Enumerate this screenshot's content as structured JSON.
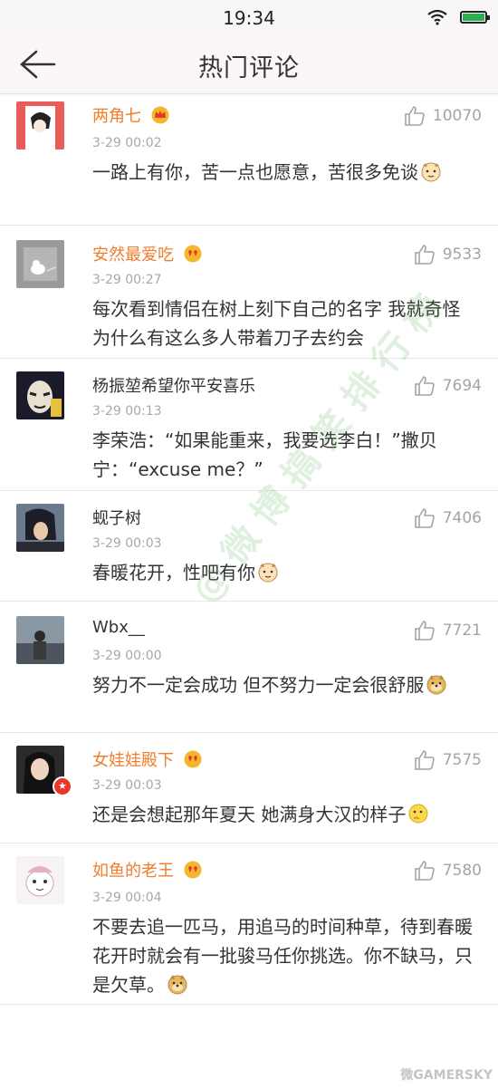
{
  "status_bar": {
    "time": "19:34"
  },
  "header": {
    "title": "热门评论"
  },
  "comments": [
    {
      "name": "两角七",
      "time": "3-29 00:02",
      "likes": "10070",
      "text": "一路上有你，苦一点也愿意，苦很多免谈"
    },
    {
      "name": "安然最爱吃",
      "time": "3-29 00:27",
      "likes": "9533",
      "text": "每次看到情侣在树上刻下自己的名字 我就奇怪为什么有这么多人带着刀子去约会"
    },
    {
      "name": "杨振堃希望你平安喜乐",
      "time": "3-29 00:13",
      "likes": "7694",
      "text": "李荣浩：“如果能重来，我要选李白！”撒贝宁：“excuse me？”"
    },
    {
      "name": "蚬子树",
      "time": "3-29 00:03",
      "likes": "7406",
      "text": "春暖花开，性吧有你"
    },
    {
      "name": "Wbx__",
      "time": "3-29 00:00",
      "likes": "7721",
      "text": "努力不一定会成功 但不努力一定会很舒服"
    },
    {
      "name": "女娃娃殿下",
      "time": "3-29 00:03",
      "likes": "7575",
      "text": "还是会想起那年夏天 她满身大汉的样子"
    },
    {
      "name": "如鱼的老王",
      "time": "3-29 00:04",
      "likes": "7580",
      "text": "不要去追一匹马，用追马的时间种草，待到春暖花开时就会有一批骏马任你挑选。你不缺马，只是欠草。"
    }
  ],
  "watermark": {
    "text": "@微博搞笑排行榜",
    "corner_text": "微GAMERSKY"
  },
  "colors": {
    "vip_name": "#f07c2c",
    "time": "#a8a8a8",
    "like": "#a4a4a4",
    "divider": "#e7e7e7"
  }
}
